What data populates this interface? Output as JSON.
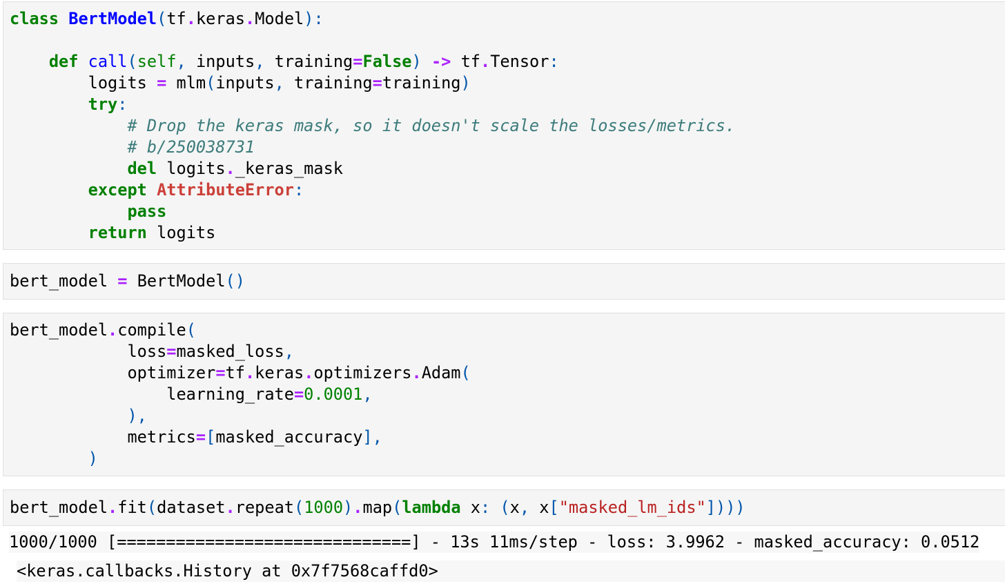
{
  "cell1": {
    "lines": [
      [
        [
          "kw",
          "class"
        ],
        [
          "",
          "&nbsp;"
        ],
        [
          "cls",
          "BertModel"
        ],
        [
          "pu",
          "("
        ],
        [
          "",
          "tf"
        ],
        [
          "op",
          "."
        ],
        [
          "",
          "keras"
        ],
        [
          "op",
          "."
        ],
        [
          "",
          "Model"
        ],
        [
          "pu",
          "):"
        ]
      ],
      [],
      [
        [
          "",
          "    "
        ],
        [
          "kw",
          "def"
        ],
        [
          "",
          "&nbsp;"
        ],
        [
          "fn",
          "call"
        ],
        [
          "pu",
          "("
        ],
        [
          "bi",
          "self"
        ],
        [
          "pu",
          ","
        ],
        [
          "",
          "&nbsp;inputs"
        ],
        [
          "pu",
          ","
        ],
        [
          "",
          "&nbsp;training"
        ],
        [
          "op",
          "="
        ],
        [
          "kw",
          "False"
        ],
        [
          "pu",
          ")"
        ],
        [
          "",
          "&nbsp;"
        ],
        [
          "op",
          "->"
        ],
        [
          "",
          "&nbsp;tf"
        ],
        [
          "op",
          "."
        ],
        [
          "",
          "Tensor"
        ],
        [
          "pu",
          ":"
        ]
      ],
      [
        [
          "",
          "        logits&nbsp;"
        ],
        [
          "op",
          "="
        ],
        [
          "",
          "&nbsp;mlm"
        ],
        [
          "pu",
          "("
        ],
        [
          "",
          "inputs"
        ],
        [
          "pu",
          ","
        ],
        [
          "",
          "&nbsp;training"
        ],
        [
          "op",
          "="
        ],
        [
          "",
          "training"
        ],
        [
          "pu",
          ")"
        ]
      ],
      [
        [
          "",
          "        "
        ],
        [
          "kw",
          "try"
        ],
        [
          "pu",
          ":"
        ]
      ],
      [
        [
          "",
          "            "
        ],
        [
          "cm",
          "# Drop the keras mask, so it doesn't scale the losses/metrics."
        ]
      ],
      [
        [
          "",
          "            "
        ],
        [
          "cm",
          "# b/250038731"
        ]
      ],
      [
        [
          "",
          "            "
        ],
        [
          "kw",
          "del"
        ],
        [
          "",
          "&nbsp;logits"
        ],
        [
          "op",
          "."
        ],
        [
          "",
          "_keras_mask"
        ]
      ],
      [
        [
          "",
          "        "
        ],
        [
          "kw",
          "except"
        ],
        [
          "",
          "&nbsp;"
        ],
        [
          "exc",
          "AttributeError"
        ],
        [
          "pu",
          ":"
        ]
      ],
      [
        [
          "",
          "            "
        ],
        [
          "kw",
          "pass"
        ]
      ],
      [
        [
          "",
          "        "
        ],
        [
          "kw",
          "return"
        ],
        [
          "",
          "&nbsp;logits"
        ]
      ]
    ]
  },
  "cell2": {
    "lines": [
      [
        [
          "",
          "bert_model&nbsp;"
        ],
        [
          "op",
          "="
        ],
        [
          "",
          "&nbsp;BertModel"
        ],
        [
          "pu",
          "()"
        ]
      ]
    ]
  },
  "cell3": {
    "lines": [
      [
        [
          "",
          "bert_model"
        ],
        [
          "op",
          "."
        ],
        [
          "",
          "compile"
        ],
        [
          "pu",
          "("
        ]
      ],
      [
        [
          "",
          "            loss"
        ],
        [
          "op",
          "="
        ],
        [
          "",
          "masked_loss"
        ],
        [
          "pu",
          ","
        ]
      ],
      [
        [
          "",
          "            optimizer"
        ],
        [
          "op",
          "="
        ],
        [
          "",
          "tf"
        ],
        [
          "op",
          "."
        ],
        [
          "",
          "keras"
        ],
        [
          "op",
          "."
        ],
        [
          "",
          "optimizers"
        ],
        [
          "op",
          "."
        ],
        [
          "",
          "Adam"
        ],
        [
          "pu",
          "("
        ]
      ],
      [
        [
          "",
          "                learning_rate"
        ],
        [
          "op",
          "="
        ],
        [
          "num",
          "0.0001"
        ],
        [
          "pu",
          ","
        ]
      ],
      [
        [
          "",
          "            "
        ],
        [
          "pu",
          "),"
        ]
      ],
      [
        [
          "",
          "            metrics"
        ],
        [
          "op",
          "="
        ],
        [
          "pu",
          "["
        ],
        [
          "",
          "masked_accuracy"
        ],
        [
          "pu",
          "],"
        ]
      ],
      [
        [
          "",
          "        "
        ],
        [
          "pu",
          ")"
        ]
      ]
    ]
  },
  "cell4": {
    "lines": [
      [
        [
          "",
          "bert_model"
        ],
        [
          "op",
          "."
        ],
        [
          "",
          "fit"
        ],
        [
          "pu",
          "("
        ],
        [
          "",
          "dataset"
        ],
        [
          "op",
          "."
        ],
        [
          "",
          "repeat"
        ],
        [
          "pu",
          "("
        ],
        [
          "num",
          "1000"
        ],
        [
          "pu",
          ")"
        ],
        [
          "op",
          "."
        ],
        [
          "",
          "map"
        ],
        [
          "pu",
          "("
        ],
        [
          "kw",
          "lambda"
        ],
        [
          "",
          "&nbsp;x"
        ],
        [
          "pu",
          ":"
        ],
        [
          "",
          "&nbsp;"
        ],
        [
          "pu",
          "("
        ],
        [
          "",
          "x"
        ],
        [
          "pu",
          ","
        ],
        [
          "",
          "&nbsp;x"
        ],
        [
          "pu",
          "["
        ],
        [
          "str",
          "\"masked_lm_ids\""
        ],
        [
          "pu",
          "])))"
        ]
      ]
    ]
  },
  "output": {
    "progress": "1000/1000 [==============================] - 13s 11ms/step - loss: 3.9962 - masked_accuracy: 0.0512",
    "result": "<keras.callbacks.History at 0x7f7568caffd0>"
  }
}
